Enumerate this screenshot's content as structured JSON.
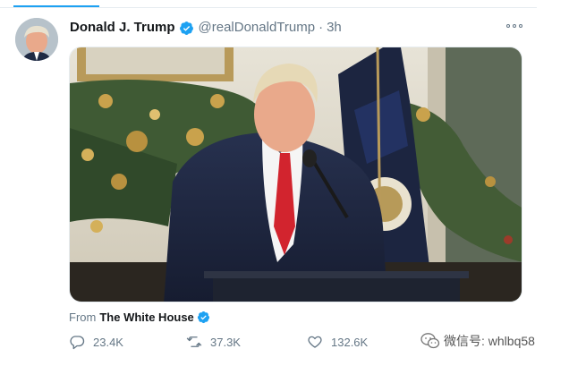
{
  "tweet": {
    "display_name": "Donald J. Trump",
    "handle": "@realDonaldTrump",
    "separator": "·",
    "timestamp": "3h",
    "source_prefix": "From",
    "source_name": "The White House",
    "reply_count": "23.4K",
    "retweet_count": "37.3K",
    "like_count": "132.6K"
  },
  "icons": {
    "verified": "verified-badge-icon",
    "more": "more-options-icon",
    "reply": "reply-icon",
    "retweet": "retweet-icon",
    "like": "heart-icon",
    "watermark": "wechat-icon"
  },
  "watermark": {
    "text": "微信号: whlbq58"
  },
  "colors": {
    "accent": "#1da1f2",
    "secondary_text": "#657786",
    "primary_text": "#14171a"
  }
}
